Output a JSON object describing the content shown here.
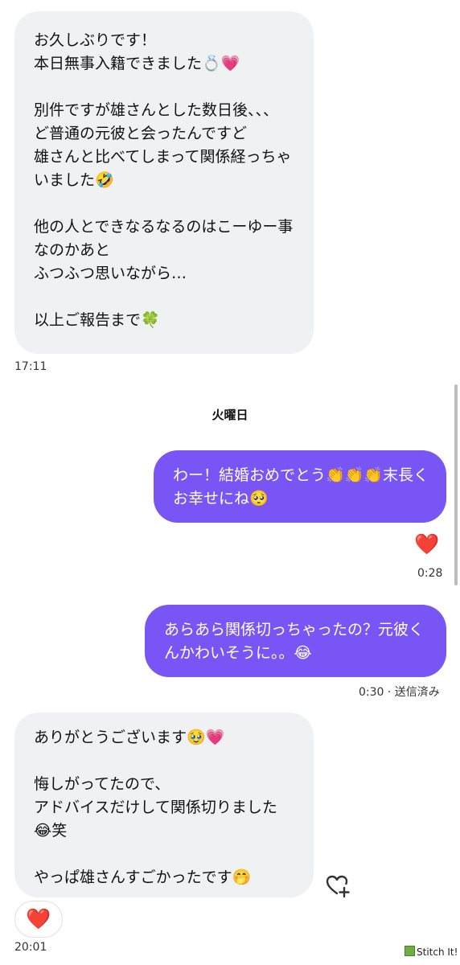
{
  "conversation": {
    "messages": [
      {
        "from": "other",
        "text": "お久しぶりです！\n本日無事入籍できました💍💗\n\n別件ですが雄さんとした数日後、、、\nど普通の元彼と会ったんですど\n雄さんと比べてしまって関係経っちゃいました🤣\n\n他の人とできなるなるのはこーゆー事なのかあと\nふつふつ思いながら…\n\n以上ご報告まで🍀",
        "time": "17:11"
      },
      {
        "from": "me",
        "text": "わー！結婚おめでとう👏👏👏末長くお幸せにね🥺",
        "reaction": "❤️",
        "time": "0:28"
      },
      {
        "from": "me",
        "text": "あらあら関係切っちゃったの？元彼くんかわいそうに。。😂",
        "time": "0:30 · 送信済み"
      },
      {
        "from": "other",
        "text": "ありがとうございます🥹💗\n\n悔しがってたので、\nアドバイスだけして関係切りました😂笑\n\nやっぱ雄さんすごかったです🤭",
        "reaction": "❤️",
        "time": "20:01"
      }
    ],
    "day_divider": "火曜日"
  },
  "icons": {
    "add_reaction": "heart-plus-icon",
    "reaction": "red-heart"
  },
  "watermark": "Stitch It!",
  "colors": {
    "outgoing_bubble": "#7a55f5",
    "incoming_bubble": "#eff1f2",
    "reaction_heart": "#e4202e"
  }
}
